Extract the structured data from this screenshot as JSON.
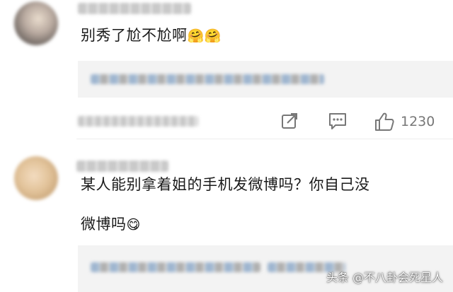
{
  "comments": [
    {
      "text": "别秀了尬不尬啊",
      "emoji": "🤗🤗",
      "like_count": "1230",
      "icons": [
        "share-icon",
        "comment-icon",
        "like-icon"
      ]
    },
    {
      "text_line1": "某人能别拿着姐的手机发微博吗？你自己没",
      "text_line2": "微博吗",
      "emoji": "😋"
    }
  ],
  "watermark": "头条 @不八卦会死星人"
}
